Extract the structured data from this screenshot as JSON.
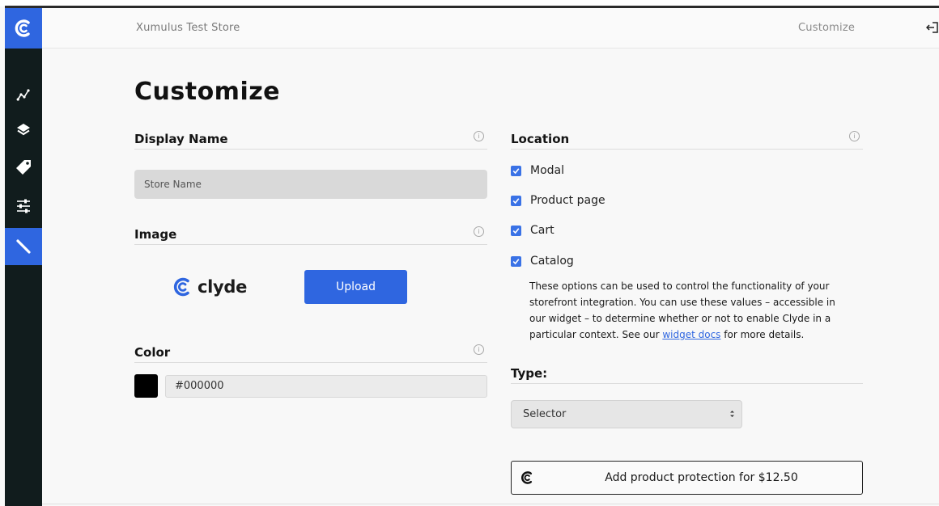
{
  "header": {
    "store_name": "Xumulus Test Store",
    "nav_link": "Customize"
  },
  "sidebar": {
    "items": [
      {
        "icon": "chart-line-icon",
        "active": false
      },
      {
        "icon": "layers-icon",
        "active": false
      },
      {
        "icon": "tag-icon",
        "active": false
      },
      {
        "icon": "sliders-icon",
        "active": false
      },
      {
        "icon": "pencil-icon",
        "active": true
      }
    ]
  },
  "page": {
    "title": "Customize"
  },
  "display_name": {
    "label": "Display Name",
    "placeholder": "Store Name"
  },
  "image": {
    "label": "Image",
    "logo_text": "clyde",
    "upload_label": "Upload"
  },
  "color": {
    "label": "Color",
    "value": "#000000"
  },
  "location": {
    "label": "Location",
    "options": [
      {
        "label": "Modal",
        "checked": true
      },
      {
        "label": "Product page",
        "checked": true
      },
      {
        "label": "Cart",
        "checked": true
      },
      {
        "label": "Catalog",
        "checked": true
      }
    ],
    "help_prefix": "These options can be used to control the functionality of your storefront integration. You can use these values – accessible in our widget – to determine whether or not to enable Clyde in a particular context. See our ",
    "help_link": "widget docs",
    "help_suffix": " for more details."
  },
  "type": {
    "label": "Type:",
    "selected": "Selector"
  },
  "preview": {
    "button_label": "Add product protection for $12.50"
  },
  "colors": {
    "accent": "#2f66e0",
    "sidebar_bg": "#111c1d"
  }
}
